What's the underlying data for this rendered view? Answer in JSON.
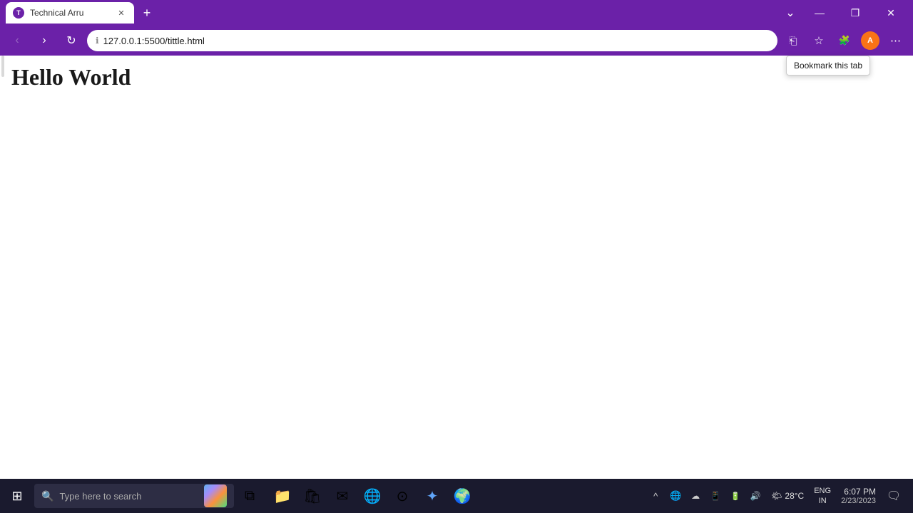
{
  "browser": {
    "tab_title": "Technical Arru",
    "tab_favicon_letter": "T",
    "url": "127.0.0.1:5500/tittle.html",
    "url_full": "127.0.0.1:5500/tittle.html",
    "new_tab_label": "+",
    "bookmark_tooltip": "Bookmark this tab"
  },
  "nav_buttons": {
    "back": "‹",
    "forward": "›",
    "refresh": "↻"
  },
  "title_bar_controls": {
    "overflow": "⌄",
    "minimize": "—",
    "restore": "❐",
    "close": "✕"
  },
  "page": {
    "heading": "Hello World"
  },
  "taskbar": {
    "start_icon": "⊞",
    "search_placeholder": "Type here to search",
    "apps": [
      {
        "name": "task-view",
        "icon": "⧉"
      },
      {
        "name": "file-explorer",
        "icon": "📁"
      },
      {
        "name": "microsoft-store",
        "icon": "🛍"
      },
      {
        "name": "mail",
        "icon": "✉"
      },
      {
        "name": "edge",
        "icon": "🌐"
      },
      {
        "name": "chrome",
        "icon": "⊙"
      },
      {
        "name": "vscode",
        "icon": "✦"
      },
      {
        "name": "browser-alt",
        "icon": "🌍"
      }
    ],
    "sys_tray": {
      "weather": "28°C",
      "weather_icon": "🌤",
      "language": "ENG\nIN",
      "time": "6:07 PM",
      "date": "2/23/2023",
      "notification_icon": "🗨"
    }
  },
  "profile": {
    "initial": "A"
  }
}
